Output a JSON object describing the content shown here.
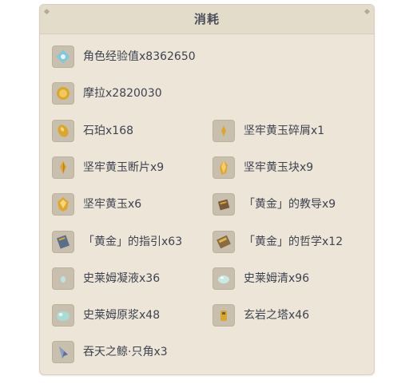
{
  "panel": {
    "title": "消耗"
  },
  "items": [
    {
      "label": "角色经验值x8362650",
      "icon": "hero-wit-icon"
    },
    {
      "label": "摩拉x2820030",
      "icon": "mora-icon"
    },
    {
      "label": "石珀x168",
      "icon": "cor-lapis-icon"
    },
    {
      "label": "坚牢黄玉碎屑x1",
      "icon": "topaz-sliver-icon"
    },
    {
      "label": "坚牢黄玉断片x9",
      "icon": "topaz-fragment-icon"
    },
    {
      "label": "坚牢黄玉块x9",
      "icon": "topaz-chunk-icon"
    },
    {
      "label": "坚牢黄玉x6",
      "icon": "topaz-gemstone-icon"
    },
    {
      "label": "「黄金」的教导x9",
      "icon": "teachings-of-gold-icon"
    },
    {
      "label": "「黄金」的指引x63",
      "icon": "guide-to-gold-icon"
    },
    {
      "label": "「黄金」的哲学x12",
      "icon": "philosophies-of-gold-icon"
    },
    {
      "label": "史莱姆凝液x36",
      "icon": "slime-condensate-icon"
    },
    {
      "label": "史莱姆清x96",
      "icon": "slime-secretions-icon"
    },
    {
      "label": "史莱姆原浆x48",
      "icon": "slime-concentrate-icon"
    },
    {
      "label": "玄岩之塔x46",
      "icon": "basalt-pillar-icon"
    },
    {
      "label": "吞天之鲸·只角x3",
      "icon": "whale-horn-icon"
    }
  ],
  "colors": {
    "panel_bg": "#ece5d8",
    "header_bg": "#e4dccb",
    "text": "#3f4350",
    "icon_bg": "#c9bfae",
    "gold": "#d9a72c"
  }
}
